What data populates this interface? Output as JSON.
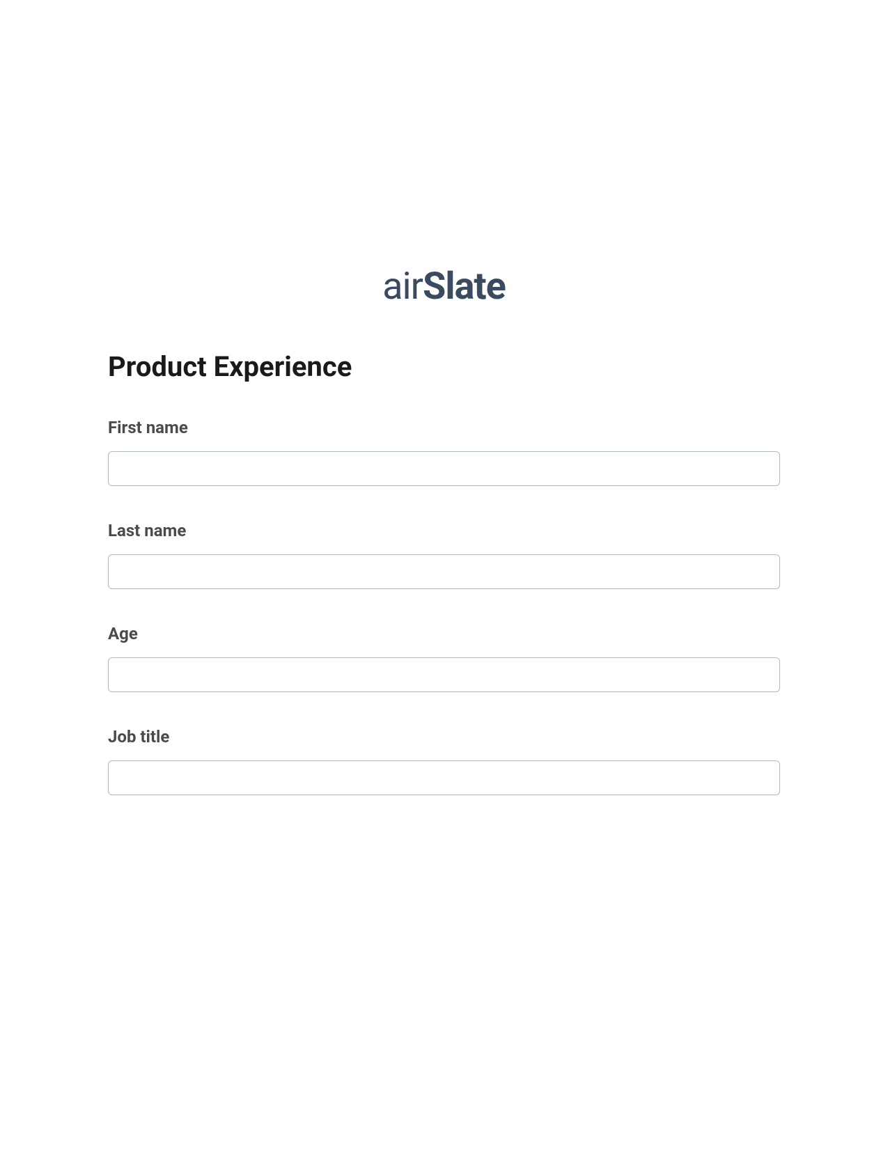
{
  "logo": {
    "brand": "airSlate"
  },
  "form": {
    "title": "Product Experience",
    "fields": [
      {
        "label": "First name",
        "value": ""
      },
      {
        "label": "Last name",
        "value": ""
      },
      {
        "label": "Age",
        "value": ""
      },
      {
        "label": "Job title",
        "value": ""
      }
    ]
  }
}
